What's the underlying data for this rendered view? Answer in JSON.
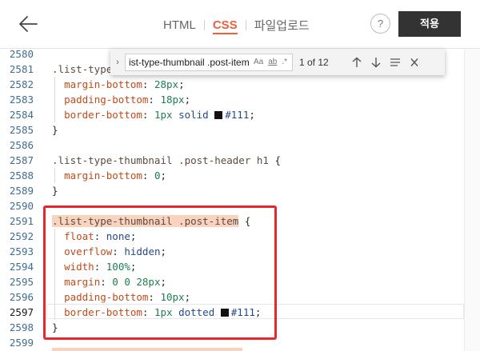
{
  "toolbar": {
    "tabs": [
      {
        "label": "HTML",
        "active": false
      },
      {
        "label": "CSS",
        "active": true
      },
      {
        "label": "파일업로드",
        "active": false
      }
    ],
    "help_label": "?",
    "apply_label": "적용"
  },
  "find_widget": {
    "query": "ist-type-thumbnail .post-item",
    "match_case": "Aa",
    "whole_word": "ab",
    "regex": ".*",
    "count": "1 of 12"
  },
  "editor": {
    "current_line": "2597",
    "line_numbers": [
      "2580",
      "2581",
      "2582",
      "2583",
      "2584",
      "2585",
      "2586",
      "2587",
      "2588",
      "2589",
      "2590",
      "2591",
      "2592",
      "2593",
      "2594",
      "2595",
      "2596",
      "2597",
      "2598",
      "2599"
    ],
    "code": {
      "l2581_sel": ".list-type",
      "l2582_prop": "margin-bottom",
      "l2582_val": "28px",
      "l2583_prop": "padding-bottom",
      "l2583_val": "18px",
      "l2584_prop": "border-bottom",
      "l2584_v1": "1px",
      "l2584_v2": "solid",
      "l2584_color": "#111",
      "l2585": "}",
      "l2587_sel": ".list-type-thumbnail .post-header h1",
      "l2587_brace": " {",
      "l2588_prop": "margin-bottom",
      "l2588_val": "0",
      "l2589": "}",
      "l2591_sel": ".list-type-thumbnail .post-item",
      "l2591_brace": " {",
      "l2592_prop": "float",
      "l2592_val": "none",
      "l2593_prop": "overflow",
      "l2593_val": "hidden",
      "l2594_prop": "width",
      "l2594_val": "100%",
      "l2595_prop": "margin",
      "l2595_val": "0 0 28px",
      "l2596_prop": "padding-bottom",
      "l2596_val": "10px",
      "l2597_prop": "border-bottom",
      "l2597_v1": "1px",
      "l2597_v2": "dotted",
      "l2597_color": "#111",
      "l2598": "}"
    }
  },
  "colors": {
    "accent": "#e8603c",
    "apply_bg": "#333333",
    "annotation": "#e8262f",
    "search_highlight": "#f9d3bd"
  },
  "icons": [
    "back-arrow-icon",
    "help-icon",
    "chevron-right-icon",
    "arrow-up-icon",
    "arrow-down-icon",
    "menu-lines-icon",
    "close-icon"
  ]
}
